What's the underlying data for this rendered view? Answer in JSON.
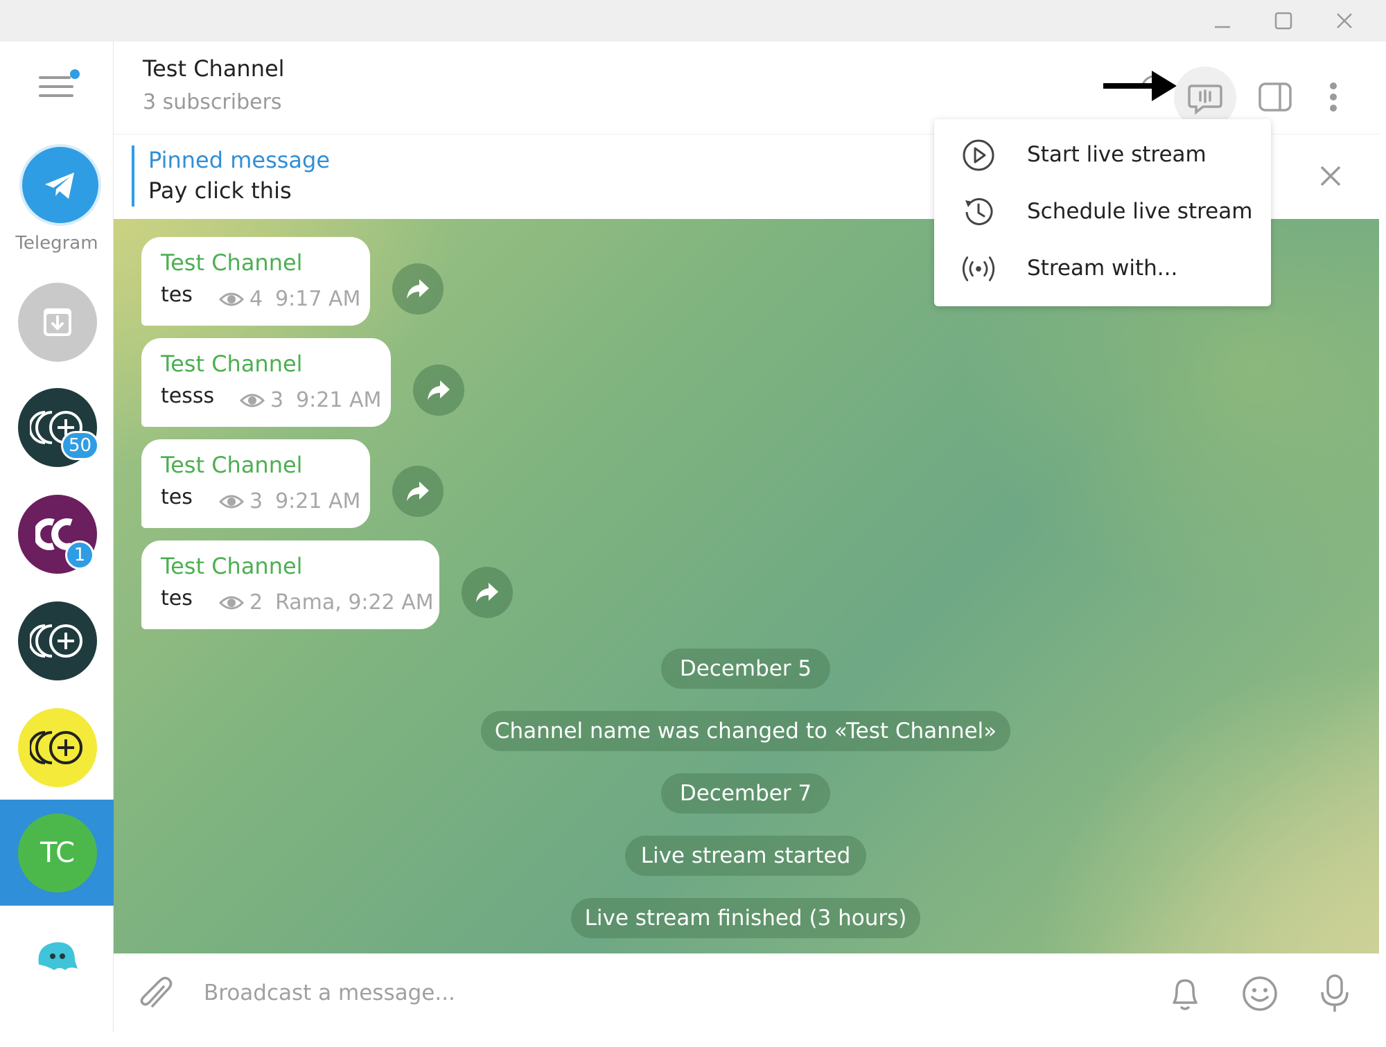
{
  "window": {
    "minimize_icon": "minimize-icon",
    "maximize_icon": "maximize-icon",
    "close_icon": "close-icon"
  },
  "sidebar": {
    "telegram_label": "Telegram",
    "folders": [
      {
        "name": "Telegram",
        "icon": "telegram-icon",
        "color": "#2f9de3"
      },
      {
        "name": "archive",
        "icon": "archive-icon",
        "color": "#c8c8c8"
      },
      {
        "name": "channel-1",
        "icon": "coins-icon",
        "color": "#1f3b3d",
        "badge": "50"
      },
      {
        "name": "channel-2",
        "icon": "cc-icon",
        "color": "#6b1f5e",
        "badge": "1"
      },
      {
        "name": "channel-3",
        "icon": "coins-icon",
        "color": "#1f3b3d"
      },
      {
        "name": "channel-4",
        "icon": "coins-icon",
        "color": "#f4ea3a"
      },
      {
        "name": "Test Channel",
        "initials": "TC",
        "color": "#4cb84c",
        "active": true
      },
      {
        "name": "bot",
        "icon": "ghost-icon",
        "color": "#3fc4d9"
      }
    ]
  },
  "header": {
    "title": "Test Channel",
    "subtitle": "3 subscribers"
  },
  "pinned": {
    "title": "Pinned message",
    "text": "Pay click this"
  },
  "messages": [
    {
      "author": "Test Channel",
      "text": "tes",
      "views": "4",
      "time": "9:17 AM"
    },
    {
      "author": "Test Channel",
      "text": "tesss",
      "views": "3",
      "time": "9:21 AM"
    },
    {
      "author": "Test Channel",
      "text": "tes",
      "views": "3",
      "time": "9:21 AM"
    },
    {
      "author": "Test Channel",
      "text": "tes",
      "views": "2",
      "time": "Rama, 9:22 AM"
    }
  ],
  "service_messages": [
    "December 5",
    "Channel name was changed to «Test Channel»",
    "December 7",
    "Live stream started",
    "Live stream finished (3 hours)"
  ],
  "menu": {
    "items": [
      {
        "label": "Start live stream",
        "icon": "play-circle-icon"
      },
      {
        "label": "Schedule live stream",
        "icon": "history-clock-icon"
      },
      {
        "label": "Stream with...",
        "icon": "broadcast-icon"
      }
    ]
  },
  "input": {
    "placeholder": "Broadcast a message..."
  },
  "colors": {
    "accent": "#2f9de3",
    "author": "#4caf50",
    "active_folder": "#2f8fd8"
  }
}
